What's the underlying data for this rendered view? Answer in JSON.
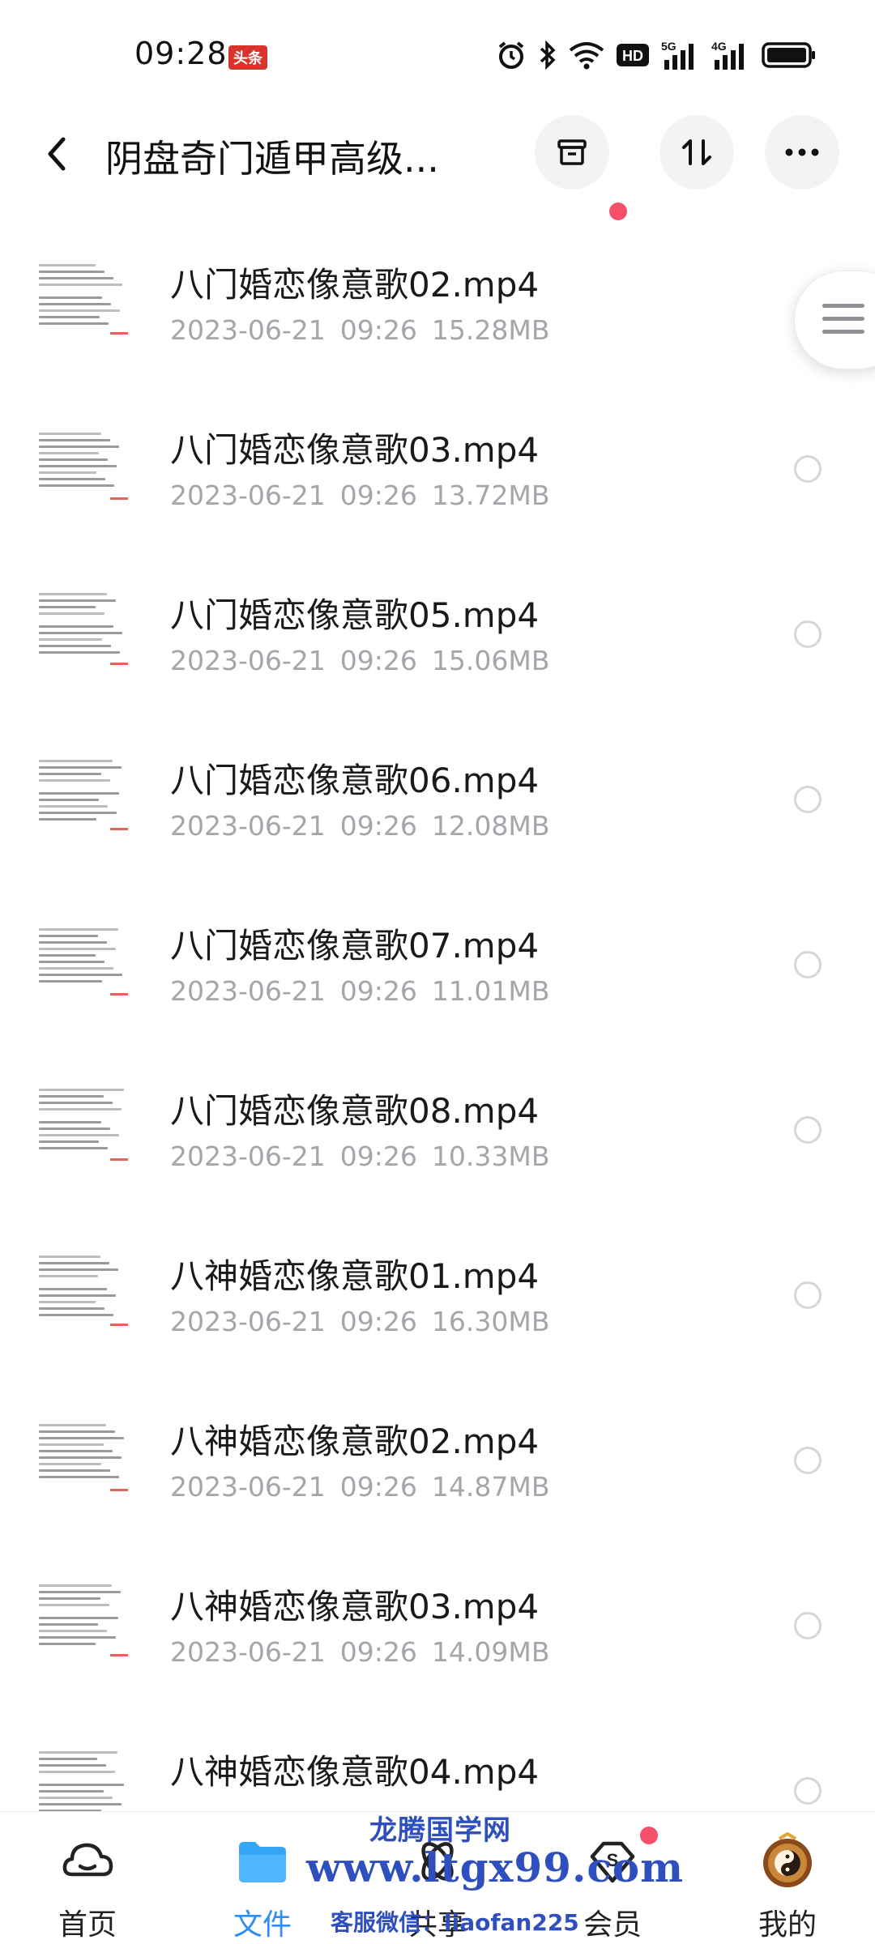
{
  "status_bar": {
    "time": "09:28",
    "badge": "头条",
    "icons": [
      "alarm-icon",
      "bluetooth-icon",
      "wifi-icon",
      "hd-icon",
      "signal-5g-icon",
      "signal-4g-icon",
      "battery-icon"
    ],
    "hd_label": "HD",
    "net1_label": "5G",
    "net2_label": "4G"
  },
  "header": {
    "title": "阴盘奇门遁甲高级...",
    "buttons": [
      "archive-icon",
      "sort-icon",
      "more-icon"
    ]
  },
  "files": [
    {
      "name": "八门婚恋像意歌02.mp4",
      "date": "2023-06-21",
      "time": "09:26",
      "size": "15.28MB"
    },
    {
      "name": "八门婚恋像意歌03.mp4",
      "date": "2023-06-21",
      "time": "09:26",
      "size": "13.72MB"
    },
    {
      "name": "八门婚恋像意歌05.mp4",
      "date": "2023-06-21",
      "time": "09:26",
      "size": "15.06MB"
    },
    {
      "name": "八门婚恋像意歌06.mp4",
      "date": "2023-06-21",
      "time": "09:26",
      "size": "12.08MB"
    },
    {
      "name": "八门婚恋像意歌07.mp4",
      "date": "2023-06-21",
      "time": "09:26",
      "size": "11.01MB"
    },
    {
      "name": "八门婚恋像意歌08.mp4",
      "date": "2023-06-21",
      "time": "09:26",
      "size": "10.33MB"
    },
    {
      "name": "八神婚恋像意歌01.mp4",
      "date": "2023-06-21",
      "time": "09:26",
      "size": "16.30MB"
    },
    {
      "name": "八神婚恋像意歌02.mp4",
      "date": "2023-06-21",
      "time": "09:26",
      "size": "14.87MB"
    },
    {
      "name": "八神婚恋像意歌03.mp4",
      "date": "2023-06-21",
      "time": "09:26",
      "size": "14.09MB"
    },
    {
      "name": "八神婚恋像意歌04.mp4",
      "date": "",
      "time": "",
      "size": ""
    }
  ],
  "bottom_nav": [
    {
      "label": "首页",
      "icon": "home-cloud-icon",
      "active": false
    },
    {
      "label": "文件",
      "icon": "folder-icon",
      "active": true
    },
    {
      "label": "共享",
      "icon": "share-icon",
      "active": false
    },
    {
      "label": "会员",
      "icon": "vip-diamond-icon",
      "active": false
    },
    {
      "label": "我的",
      "icon": "avatar-icon",
      "active": false
    }
  ],
  "watermark": {
    "line1": "龙腾国学网",
    "line2": "www.ltgx99.com",
    "line3": "客服微信：liaofan225"
  },
  "colors": {
    "accent": "#2f8cf6",
    "notification_dot": "#f4506a",
    "meta_text": "#a3a6ab",
    "watermark": "#2f4fbf"
  }
}
